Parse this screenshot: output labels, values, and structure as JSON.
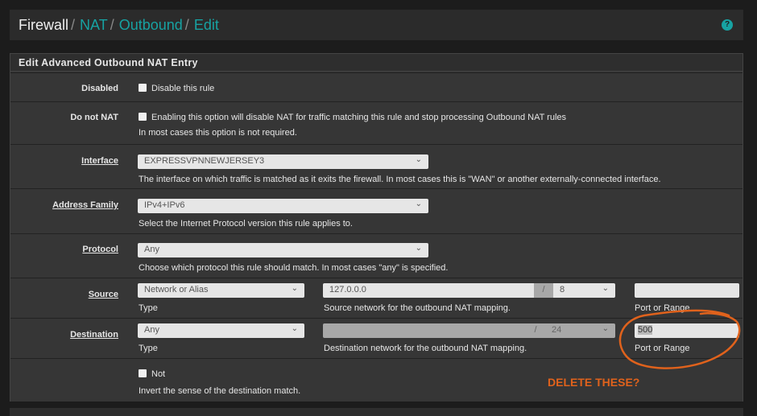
{
  "breadcrumb": {
    "current": "Firewall",
    "items": [
      "NAT",
      "Outbound",
      "Edit"
    ]
  },
  "help_icon": "question-circle-icon",
  "panel_title": "Edit Advanced Outbound NAT Entry",
  "rows": {
    "disabled": {
      "label": "Disabled",
      "checkbox": "Disable this rule",
      "checked": false
    },
    "do_not_nat": {
      "label": "Do not NAT",
      "checkbox": "Enabling this option will disable NAT for traffic matching this rule and stop processing Outbound NAT rules",
      "help": "In most cases this option is not required.",
      "checked": false
    },
    "interface": {
      "label": "Interface",
      "value": "EXPRESSVPNNEWJERSEY3",
      "help": "The interface on which traffic is matched as it exits the firewall. In most cases this is \"WAN\" or another externally-connected interface."
    },
    "address_family": {
      "label": "Address Family",
      "value": "IPv4+IPv6",
      "help": "Select the Internet Protocol version this rule applies to."
    },
    "protocol": {
      "label": "Protocol",
      "value": "Any",
      "help": "Choose which protocol this rule should match. In most cases \"any\" is specified."
    },
    "source": {
      "label": "Source",
      "type": "Network or Alias",
      "type_help": "Type",
      "network": "127.0.0.0",
      "slash": "/",
      "mask": "8",
      "network_help": "Source network for the outbound NAT mapping.",
      "port": "",
      "port_help": "Port or Range"
    },
    "destination": {
      "label": "Destination",
      "type": "Any",
      "type_help": "Type",
      "network": "",
      "slash": "/",
      "mask": "24",
      "network_help": "Destination network for the outbound NAT mapping.",
      "port": "500",
      "port_help": "Port or Range"
    },
    "not": {
      "checkbox": "Not",
      "help": "Invert the sense of the destination match.",
      "checked": false
    }
  },
  "annotation": {
    "text": "DELETE THESE?",
    "color": "#e0621c"
  }
}
